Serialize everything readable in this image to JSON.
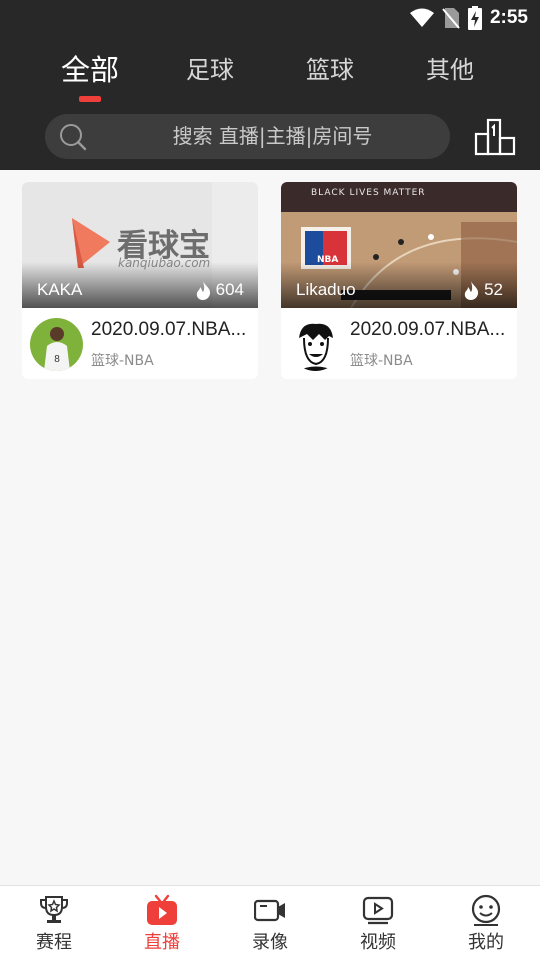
{
  "status_bar": {
    "time": "2:55"
  },
  "tabs": [
    {
      "label": "全部",
      "active": true
    },
    {
      "label": "足球",
      "active": false
    },
    {
      "label": "篮球",
      "active": false
    },
    {
      "label": "其他",
      "active": false
    }
  ],
  "search": {
    "placeholder": "搜索 直播|主播|房间号"
  },
  "cards": [
    {
      "thumb_logo_text": "看球宝",
      "thumb_logo_domain": "kanqiubao.com",
      "streamer": "KAKA",
      "views": "604",
      "title": "2020.09.07.NBA...",
      "category": "篮球-NBA"
    },
    {
      "thumb_banner_text": "BLACK LIVES MATTER",
      "thumb_logo_text": "NBA",
      "streamer": "Likaduo",
      "views": "52",
      "title": "2020.09.07.NBA...",
      "category": "篮球-NBA"
    }
  ],
  "bottom_nav": [
    {
      "label": "赛程",
      "icon": "trophy-icon",
      "active": false
    },
    {
      "label": "直播",
      "icon": "tv-icon",
      "active": true
    },
    {
      "label": "录像",
      "icon": "video-camera-icon",
      "active": false
    },
    {
      "label": "视频",
      "icon": "play-screen-icon",
      "active": false
    },
    {
      "label": "我的",
      "icon": "smiley-icon",
      "active": false
    }
  ],
  "colors": {
    "header_bg": "#282828",
    "accent": "#ef3f3a",
    "page_bg": "#f7f7f7"
  }
}
